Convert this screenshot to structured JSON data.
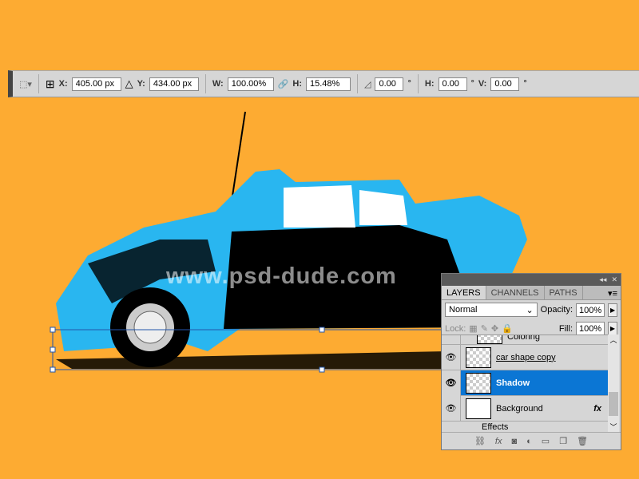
{
  "options_bar": {
    "x_label": "X:",
    "x_value": "405.00 px",
    "y_label": "Y:",
    "y_value": "434.00 px",
    "w_label": "W:",
    "w_value": "100.00%",
    "h_label": "H:",
    "h_value": "15.48%",
    "angle_value": "0.00",
    "degree": "°",
    "hskew_label": "H:",
    "hskew_value": "0.00",
    "vskew_label": "V:",
    "vskew_value": "0.00"
  },
  "watermark": "www.psd-dude.com",
  "layers_panel": {
    "tabs": [
      "LAYERS",
      "CHANNELS",
      "PATHS"
    ],
    "blend_mode": "Normal",
    "opacity_label": "Opacity:",
    "opacity_value": "100%",
    "lock_label": "Lock:",
    "fill_label": "Fill:",
    "fill_value": "100%",
    "layers": [
      {
        "name": "Coloring"
      },
      {
        "name": "car shape copy"
      },
      {
        "name": "Shadow",
        "selected": true
      },
      {
        "name": "Background",
        "fx": "fx"
      },
      {
        "name": "Effects"
      }
    ]
  },
  "colors": {
    "background": "#fdab32",
    "car_blue": "#29b6f0",
    "selection": "#0b76d4"
  }
}
